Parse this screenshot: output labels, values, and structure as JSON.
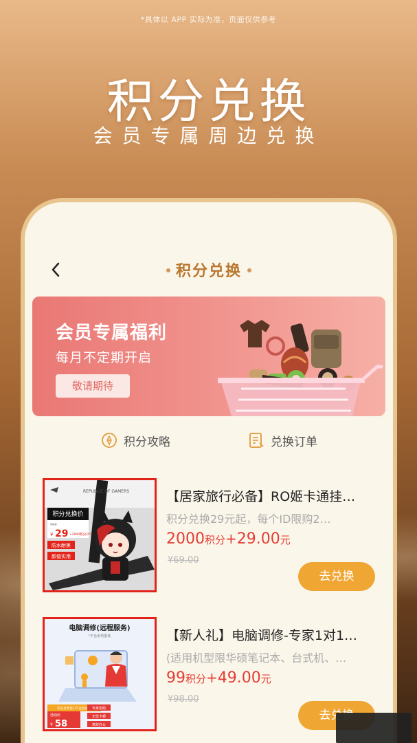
{
  "disclaimer": "*具体以 APP 实际为准，页面仅供参考",
  "hero": {
    "title": "积分兑换",
    "subtitle": "会员专属周边兑换"
  },
  "header": {
    "title": "积分兑换",
    "back_icon": "chevron-left-icon"
  },
  "banner": {
    "title": "会员专属福利",
    "subtitle": "每月不定期开启",
    "button": "敬请期待"
  },
  "shortcuts": [
    {
      "label": "积分攻略",
      "icon": "strategy-icon"
    },
    {
      "label": "兑换订单",
      "icon": "order-list-icon"
    }
  ],
  "products": [
    {
      "title": "【居家旅行必备】RO姬卡通挂…",
      "desc": "积分兑换29元起，每个ID限购2…",
      "points": "2000",
      "points_unit": "积分",
      "plus": "+",
      "cash": "29.00",
      "cash_unit": "元",
      "old_price": "¥69.00",
      "button": "去兑换",
      "thumb": {
        "logo": "REPUBLIC OF GAMERS",
        "badge_title": "积分兑换价",
        "badge_old": "¥69",
        "badge_price": "29",
        "badge_note": "+2000积分/2个",
        "tag1": "防水耐美",
        "tag2": "颜值实用"
      }
    },
    {
      "title": "【新人礼】电脑调修-专家1对1…",
      "desc": "(适用机型限华硕笔记本、台式机、…",
      "points": "99",
      "points_unit": "积分",
      "plus": "+",
      "cash": "49.00",
      "cash_unit": "元",
      "old_price": "¥98.00",
      "button": "去兑换",
      "thumb": {
        "heading": "电脑调修(远程服务)",
        "note": "*不含系统重装",
        "badge_title": "积分兑专家1V1远程服务",
        "badge_label": "活动价",
        "badge_price": "58",
        "tag1": "专家协助",
        "tag2": "无忧卡顿",
        "tag3": "高效办公"
      }
    }
  ],
  "colors": {
    "accent": "#f0a633",
    "price": "#e43d34",
    "banner": "#e97874",
    "title_gold": "#b9772f"
  }
}
